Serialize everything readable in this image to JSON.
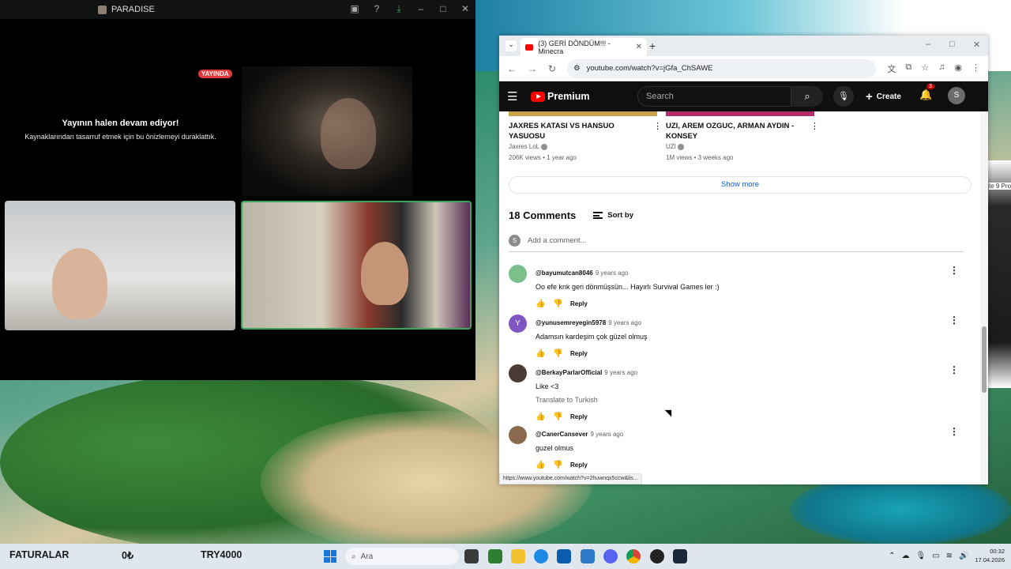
{
  "stream": {
    "title": "PARADISE",
    "live_label": "YAYINDA",
    "paused_heading": "Yayının halen devam ediyor!",
    "paused_sub": "Kaynaklarından tasarruf etmek için bu önizlemeyi duraklattık."
  },
  "browser": {
    "tab_title": "(3) GERİ DÖNDÜM!!! - Minecra",
    "url": "youtube.com/watch?v=jGfa_ChSAWE",
    "status_url": "https://www.youtube.com/watch?v=2huwnqx5ccw&lis..."
  },
  "youtube": {
    "logo": "Premium",
    "search_placeholder": "Search",
    "create_label": "Create",
    "notif_count": "3",
    "avatar_letter": "S",
    "recommendations": [
      {
        "title": "JAXRES KATASI VS HANSUO YASUOSU",
        "channel": "Jaxres LoL",
        "meta": "206K views • 1 year ago"
      },
      {
        "title": "UZI, AREM OZGUC, ARMAN AYDIN - KONSEY",
        "channel": "UZI",
        "meta": "1M views • 3 weeks ago"
      }
    ],
    "show_more": "Show more",
    "comments_count": "18 Comments",
    "sort_by": "Sort by",
    "add_comment_placeholder": "Add a comment...",
    "comments": [
      {
        "author": "@bayumutcan8046",
        "time": "9 years ago",
        "text": "Oo efe knk geri dönmüşsün... Hayırlı Survival Games ler :)",
        "translate": "",
        "reply": "Reply",
        "avatar_color": "#7bbf8a"
      },
      {
        "author": "@yunusemreyegin5978",
        "time": "9 years ago",
        "text": "Adamsın kardeşim çok güzel olmuş",
        "translate": "",
        "reply": "Reply",
        "avatar_color": "#7e57c2",
        "avatar_letter": "Y"
      },
      {
        "author": "@BerkayParlarOfficial",
        "time": "9 years ago",
        "text": "Like <3",
        "translate": "Translate to Turkish",
        "reply": "Reply",
        "avatar_color": "#4a3b34"
      },
      {
        "author": "@CanerCansever",
        "time": "9 years ago",
        "text": "guzel olmus",
        "translate": "",
        "reply": "Reply",
        "avatar_color": "#8a6a4e"
      }
    ]
  },
  "background_window": {
    "text": "te 9 Pro"
  },
  "taskbar": {
    "ticker_a": "FATURALAR",
    "ticker_b": "0₺",
    "ticker_c": "TRY4000",
    "search_label": "Ara",
    "time": "00:32",
    "date": "17.04.2026"
  }
}
